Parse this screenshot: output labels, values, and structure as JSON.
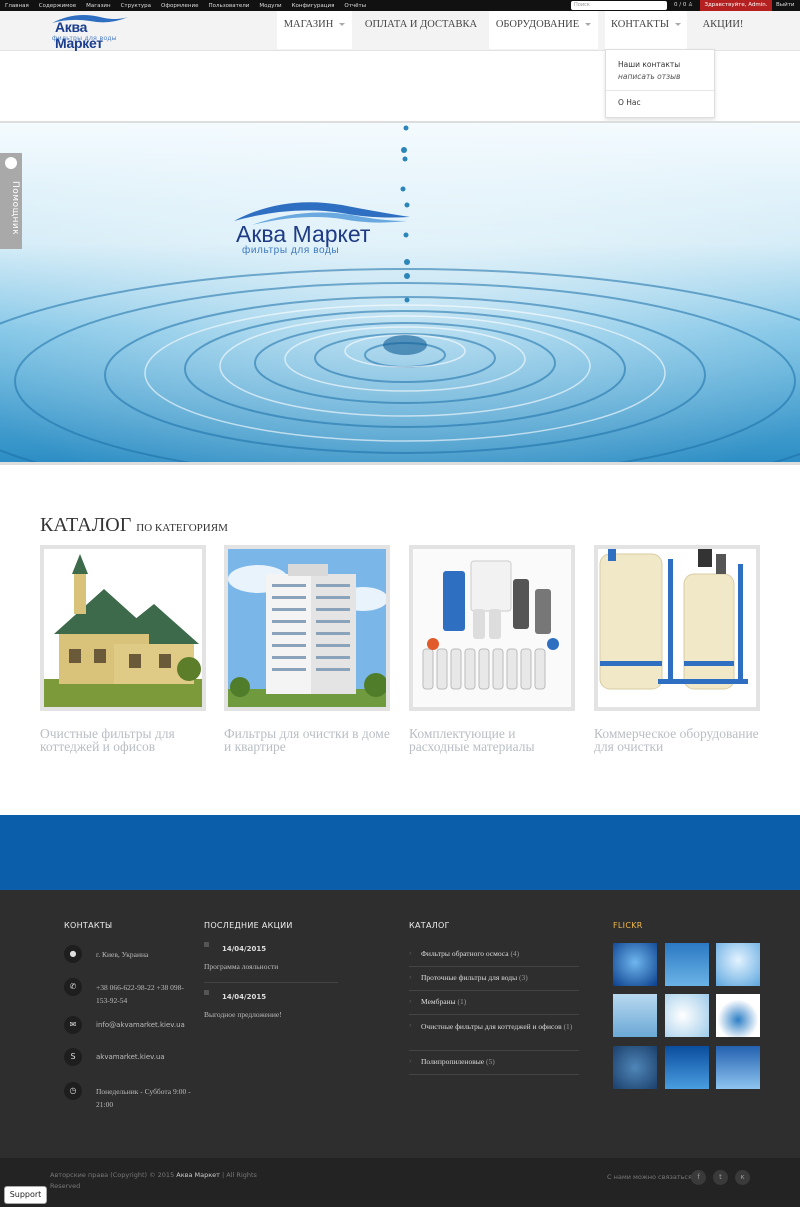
{
  "adminbar": {
    "links": [
      "Главная",
      "Содержимое",
      "Магазин",
      "Структура",
      "Оформление",
      "Пользователи",
      "Модули",
      "Конфигурация",
      "Отчёты"
    ],
    "search_placeholder": "Поиск",
    "cart": "0 / 0",
    "greeting": "Здравствуйте, Admin.",
    "logout": "Выйти"
  },
  "header": {
    "logo_brand": "Аква Маркет",
    "logo_tagline": "фильтры для воды",
    "nav": [
      "МАГАЗИН",
      "ОПЛАТА И ДОСТАВКА",
      "ОБОРУДОВАНИЕ",
      "КОНТАКТЫ",
      "АКЦИИ!"
    ],
    "dropdown": [
      "Наши контакты",
      "написать отзыв",
      "О Нас"
    ]
  },
  "hero": {
    "logo_brand": "Аква Маркет",
    "logo_tagline": "фильтры для воды"
  },
  "helper": {
    "label": "Помощник"
  },
  "catalog": {
    "title": "КАТАЛОГ",
    "subtitle": "ПО КАТЕГОРИЯМ",
    "cards": [
      "Очистные фильтры для коттеджей и офисов",
      "Фильтры для очистки в доме и квартире",
      "Комплектующие и расходные материалы",
      "Коммерческое оборудование для очистки"
    ]
  },
  "footer": {
    "contacts_heading": "КОНТАКТЫ",
    "address": "г. Киев, Украина",
    "phones": "+38 066-622-98-22 +38 098-153-92-54",
    "email": "info@akvamarket.kiev.ua",
    "skype": "akvamarket.kiev.ua",
    "hours": "Понедельник - Суббота 9:00 - 21:00",
    "promos_heading": "ПОСЛЕДНИЕ АКЦИИ",
    "promos": [
      {
        "date": "14/04/2015",
        "text": "Программа лояльности"
      },
      {
        "date": "14/04/2015",
        "text": "Выгодное предложение!"
      }
    ],
    "catalog_heading": "КАТАЛОГ",
    "catalog_items": [
      {
        "name": "Фильтры обратного осмоса",
        "count": "(4)"
      },
      {
        "name": "Проточные фильтры для воды",
        "count": "(3)"
      },
      {
        "name": "Мембраны",
        "count": "(1)"
      },
      {
        "name": "Очистные фильтры для коттеджей и офисов",
        "count": "(1)"
      },
      {
        "name": "Полипропиленовые",
        "count": "(5)"
      }
    ],
    "flickr_heading": "FLICKR"
  },
  "subfooter": {
    "copyright_prefix": "Авторские права (Copyright) © 2015",
    "copyright_brand": "Аква Маркет",
    "copyright_suffix": "| All Rights Reserved",
    "social_label": "С нами можно связаться",
    "support_button": "Support"
  },
  "colors": {
    "admin_red": "#b42020",
    "band_blue": "#0b5eaa",
    "footer_bg": "#2e2e2e"
  }
}
